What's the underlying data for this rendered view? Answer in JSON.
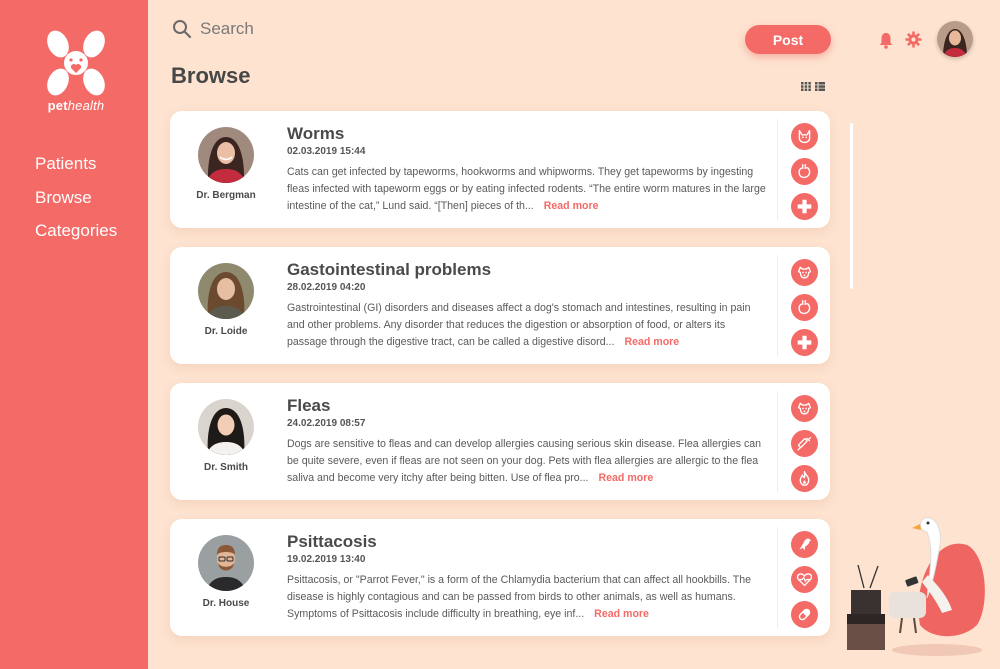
{
  "brand": {
    "name_bold": "pet",
    "name_italic": "health"
  },
  "sidebar": {
    "items": [
      {
        "label": "Patients"
      },
      {
        "label": "Browse"
      },
      {
        "label": "Categories"
      }
    ]
  },
  "search": {
    "placeholder": "Search"
  },
  "toolbar": {
    "post_label": "Post"
  },
  "page": {
    "title": "Browse"
  },
  "colors": {
    "accent": "#f46a66",
    "background": "#fde3d0",
    "card": "#ffffff"
  },
  "posts": [
    {
      "title": "Worms",
      "date": "02.03.2019 15:44",
      "doctor": "Dr. Bergman",
      "excerpt": "Cats can get infected by tapeworms, hookworms and whipworms. They get tapeworms by ingesting fleas infected with tapeworm eggs or by eating infected rodents. “The entire worm matures in the large intestine of the cat,” Lund said. “[Then] pieces of th...",
      "read_more": "Read more",
      "icons": [
        "cat-icon",
        "stomach-icon",
        "medical-cross-icon"
      ]
    },
    {
      "title": "Gastointestinal problems",
      "date": "28.02.2019 04:20",
      "doctor": "Dr. Loide",
      "excerpt": "Gastrointestinal (GI) disorders and diseases affect a dog's stomach and intestines, resulting in pain and other problems. Any disorder that reduces the digestion or absorption of food, or alters its passage through the digestive tract, can be called a digestive disord...",
      "read_more": "Read more",
      "icons": [
        "dog-icon",
        "stomach-icon",
        "medical-cross-icon"
      ]
    },
    {
      "title": "Fleas",
      "date": "24.02.2019 08:57",
      "doctor": "Dr. Smith",
      "excerpt": "Dogs are sensitive to fleas and can develop allergies causing serious skin disease. Flea allergies can be quite severe, even if fleas are not seen on your dog. Pets with flea allergies are allergic to the flea saliva and become very itchy after being bitten. Use of flea pro...",
      "read_more": "Read more",
      "icons": [
        "dog-icon",
        "syringe-icon",
        "fire-icon"
      ]
    },
    {
      "title": "Psittacosis",
      "date": "19.02.2019 13:40",
      "doctor": "Dr. House",
      "excerpt": "Psittacosis, or \"Parrot Fever,\" is a form of the Chlamydia bacterium that can affect all hookbills. The disease is highly contagious and can be passed from birds to other animals, as well as humans. Symptoms of Psittacosis include difficulty in breathing, eye inf...",
      "read_more": "Read more",
      "icons": [
        "bird-icon",
        "heartbeat-icon",
        "pill-icon"
      ]
    }
  ]
}
